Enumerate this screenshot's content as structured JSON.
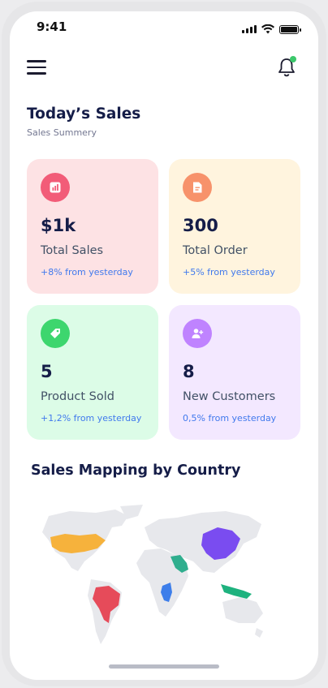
{
  "status_bar": {
    "time": "9:41",
    "battery_level": 1.0
  },
  "header": {
    "title": "Today’s Sales",
    "subtitle": "Sales Summery"
  },
  "cards": [
    {
      "value": "$1k",
      "label": "Total Sales",
      "change": "+8% from yesterday",
      "bg": "#fde2e4",
      "icon_bg": "#f25c78",
      "icon": "bar-chart-icon"
    },
    {
      "value": "300",
      "label": "Total Order",
      "change": "+5% from yesterday",
      "bg": "#fff4de",
      "icon_bg": "#f7926b",
      "icon": "document-icon"
    },
    {
      "value": "5",
      "label": "Product Sold",
      "change": "+1,2% from yesterday",
      "bg": "#dcfce7",
      "icon_bg": "#3dd66e",
      "icon": "tag-icon"
    },
    {
      "value": "8",
      "label": "New Customers",
      "change": "0,5% from yesterday",
      "bg": "#f3e8ff",
      "icon_bg": "#bf83ff",
      "icon": "add-user-icon"
    }
  ],
  "map": {
    "title": "Sales Mapping by Country",
    "highlight_colors": {
      "usa": "#f6b23c",
      "brazil": "#e64b5a",
      "saudi_arabia": "#2fae8e",
      "africa_east": "#3d7eea",
      "china": "#7a4cf0",
      "indonesia": "#1eb27e"
    },
    "base_color": "#e7e8ec"
  }
}
